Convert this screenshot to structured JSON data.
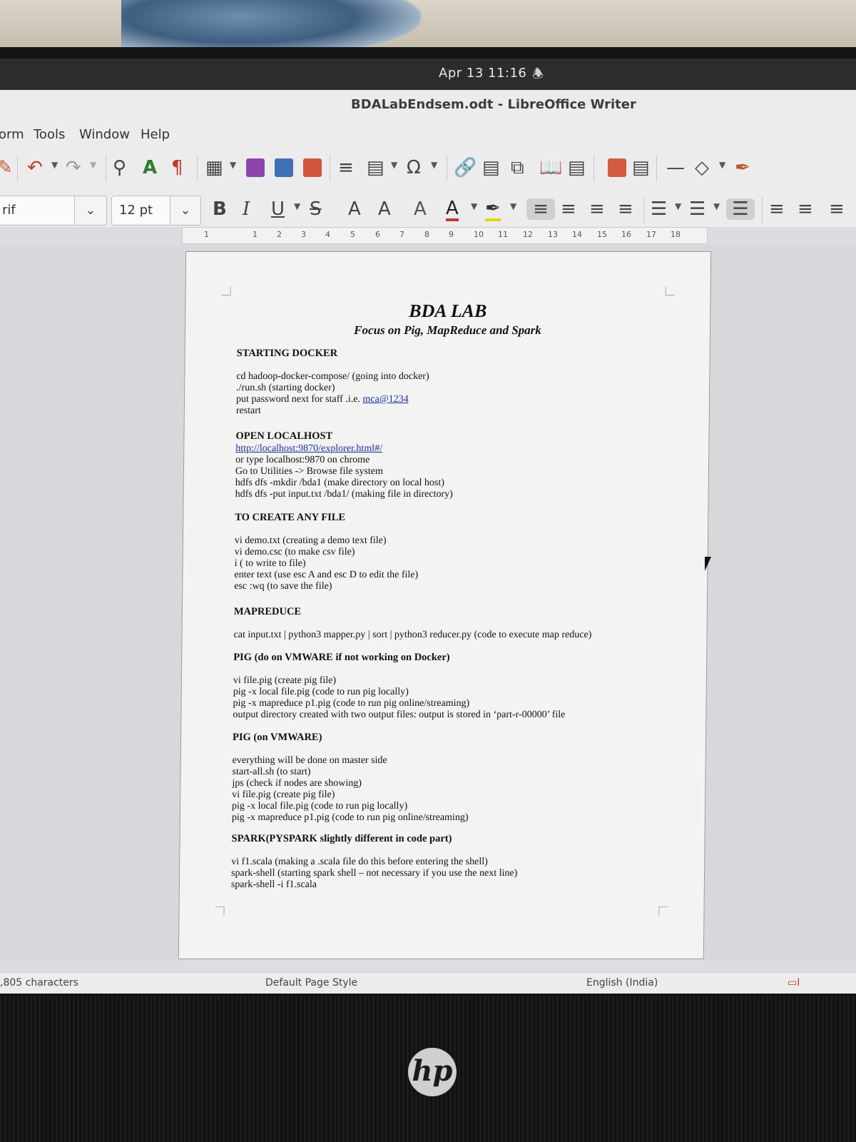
{
  "system": {
    "clock": "Apr 13  11:16"
  },
  "window": {
    "title": "BDALabEndsem.odt - LibreOffice Writer"
  },
  "menu": [
    "orm",
    "Tools",
    "Window",
    "Help"
  ],
  "toolbar": {
    "font_name": "rif",
    "font_size": "12 pt",
    "ruler_numbers": [
      "1",
      "1",
      "2",
      "3",
      "4",
      "5",
      "6",
      "7",
      "8",
      "9",
      "10",
      "11",
      "12",
      "13",
      "14",
      "15",
      "16",
      "17",
      "18"
    ]
  },
  "document": {
    "title": "BDA LAB",
    "subtitle": "Focus on Pig, MapReduce and Spark",
    "sections": [
      {
        "heading": "STARTING DOCKER",
        "lines": [
          "cd hadoop-docker-compose/ (going into docker)",
          "./run.sh (starting docker)",
          "put password next for staff .i.e. ",
          "restart"
        ],
        "link": "mca@1234"
      },
      {
        "heading": "OPEN LOCALHOST",
        "link": "http://localhost:9870/explorer.html#/",
        "lines": [
          "or type localhost:9870 on chrome",
          "Go to Utilities -> Browse file system",
          "hdfs dfs -mkdir /bda1 (make directory on local host)",
          "hdfs dfs -put input.txt /bda1/ (making file in directory)"
        ]
      },
      {
        "heading": "TO CREATE ANY FILE",
        "lines": [
          "vi demo.txt (creating a demo text file)",
          "vi demo.csc (to make csv file)",
          "i ( to write to file)",
          "enter text (use esc A and esc D to edit the file)",
          "esc :wq (to save the file)"
        ]
      },
      {
        "heading": "MAPREDUCE",
        "lines": [
          "cat input.txt | python3 mapper.py | sort | python3 reducer.py (code to execute map reduce)"
        ]
      },
      {
        "heading": "PIG (do on VMWARE if not working on Docker)",
        "lines": [
          "vi file.pig (create pig file)",
          "pig -x local file.pig (code to run pig locally)",
          "pig -x mapreduce p1.pig (code to run pig online/streaming)",
          "output directory created with two output files: output is stored in ‘part-r-00000’ file"
        ]
      },
      {
        "heading": "PIG (on VMWARE)",
        "lines": [
          "everything will be done on master side",
          "start-all.sh  (to start)",
          "jps (check if nodes are showing)",
          "vi file.pig (create pig file)",
          "pig -x local file.pig (code to run pig locally)",
          "pig -x mapreduce p1.pig (code to run pig online/streaming)"
        ]
      },
      {
        "heading": "SPARK(PYSPARK slightly different in code part)",
        "lines": [
          "vi f1.scala (making a .scala file do this before entering the shell)",
          "spark-shell (starting spark shell – not necessary if you use the next line)",
          "spark-shell -i f1.scala"
        ]
      }
    ]
  },
  "status": {
    "characters": ",805 characters",
    "page_style": "Default Page Style",
    "language": "English (India)"
  },
  "brand": {
    "logo": "hp"
  }
}
